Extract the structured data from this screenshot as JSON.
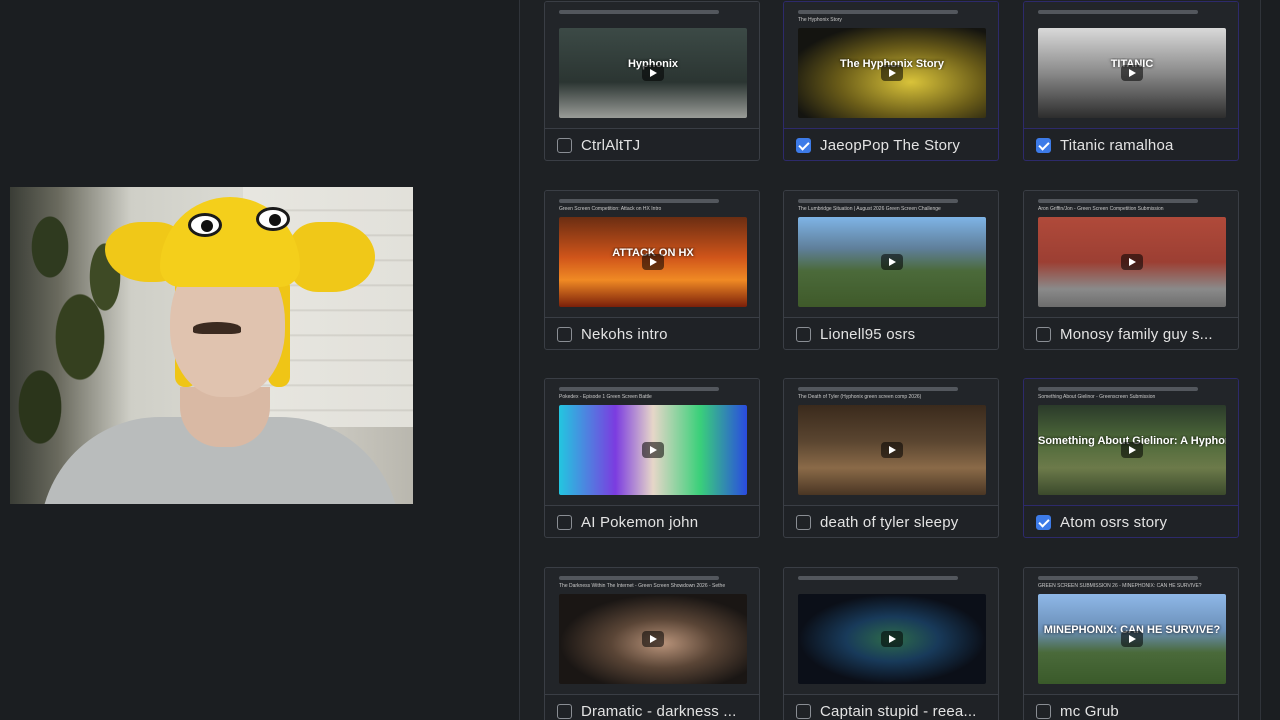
{
  "cards": [
    {
      "label": "CtrlAltTJ",
      "checked": false,
      "thumb_title": "",
      "thumb_text": "Hyphonix",
      "bg": "linear-gradient(180deg,#3c4a46 0%,#2b3532 60%,#9a9c98 100%)"
    },
    {
      "label": "JaeopPop The Story",
      "checked": true,
      "thumb_title": "The Hyphonix Story",
      "thumb_text": "The Hyphonix Story",
      "bg": "radial-gradient(ellipse at 60% 60%,#d9c33a 0%,#6a5c18 45%,#141410 80%)"
    },
    {
      "label": "Titanic ramalhoa",
      "checked": true,
      "thumb_title": "",
      "thumb_text": "TITANIC",
      "bg": "linear-gradient(180deg,#d9d9d9 0%,#8a8a8a 50%,#2d2d2d 100%)"
    },
    {
      "label": "Nekohs intro",
      "checked": false,
      "thumb_title": "Green Screen Competition: Attack on HX Intro",
      "thumb_text": "ATTACK ON HX",
      "bg": "linear-gradient(180deg,#6b2d12 0%,#d0551a 45%,#f08a24 70%,#7a1f0a 100%)"
    },
    {
      "label": "Lionell95 osrs",
      "checked": false,
      "thumb_title": "The Lumbridge Situation | August 2026 Green Screen Challenge",
      "thumb_text": "",
      "bg": "linear-gradient(180deg,#7fb4e6 0%,#5f7f9a 35%,#4b6a3a 60%,#3f5a2a 100%)"
    },
    {
      "label": "Monosy family guy s...",
      "checked": false,
      "thumb_title": "Aron Griffin/Jon - Green Screen Competition Submission",
      "thumb_text": "",
      "bg": "linear-gradient(180deg,#b04a3a 0%,#9c3f33 50%,#8a8a8a 80%,#6d6d6d 100%)"
    },
    {
      "label": "AI Pokemon john",
      "checked": false,
      "thumb_title": "Pokedex - Episode 1 Green Screen Battle",
      "thumb_text": "",
      "bg": "linear-gradient(90deg,#23c6e0 0%,#7b3ce0 30%,#e6d6c8 50%,#3ad07a 75%,#2a4be0 100%)"
    },
    {
      "label": "death of tyler sleepy",
      "checked": false,
      "thumb_title": "The Death of Tyler (Hyphonix green screen comp 2026)",
      "thumb_text": "",
      "bg": "linear-gradient(180deg,#3a2a1c 0%,#5a4530 40%,#8a6a48 70%,#4a3624 100%)"
    },
    {
      "label": "Atom osrs story",
      "checked": true,
      "thumb_title": "Something About Gielinor - Greenscreen Submission",
      "thumb_text": "Something About Gielinor: A Hyphonix Story",
      "bg": "linear-gradient(180deg,#2a3a2a 0%,#4f6a3a 40%,#6c7a4a 70%,#3b4a2c 100%)"
    },
    {
      "label": "Dramatic - darkness ...",
      "checked": false,
      "thumb_title": "The Darkness Within The Internet - Green Screen Showdown 2026 - Sethe",
      "thumb_text": "",
      "bg": "radial-gradient(ellipse at 55% 55%,#b8937a 0%,#5a4536 35%,#1a1614 70%)"
    },
    {
      "label": "Captain stupid - reea...",
      "checked": false,
      "thumb_title": "",
      "thumb_text": "",
      "bg": "radial-gradient(ellipse at 50% 50%,#2e6b4a 0%,#183a5a 35%,#0b0f18 70%)"
    },
    {
      "label": "mc Grub",
      "checked": false,
      "thumb_title": "GREEN SCREEN SUBMISSION 26 - MINEPHONIX: CAN HE SURVIVE?",
      "thumb_text": "MINEPHONIX: CAN HE SURVIVE?",
      "bg": "linear-gradient(180deg,#8fb8e8 0%,#6a8fb8 40%,#4a6a3a 65%,#3a5a2a 100%)"
    }
  ],
  "colors": {
    "accent": "#3d7be8",
    "selected_border": "#2d2a6b"
  }
}
